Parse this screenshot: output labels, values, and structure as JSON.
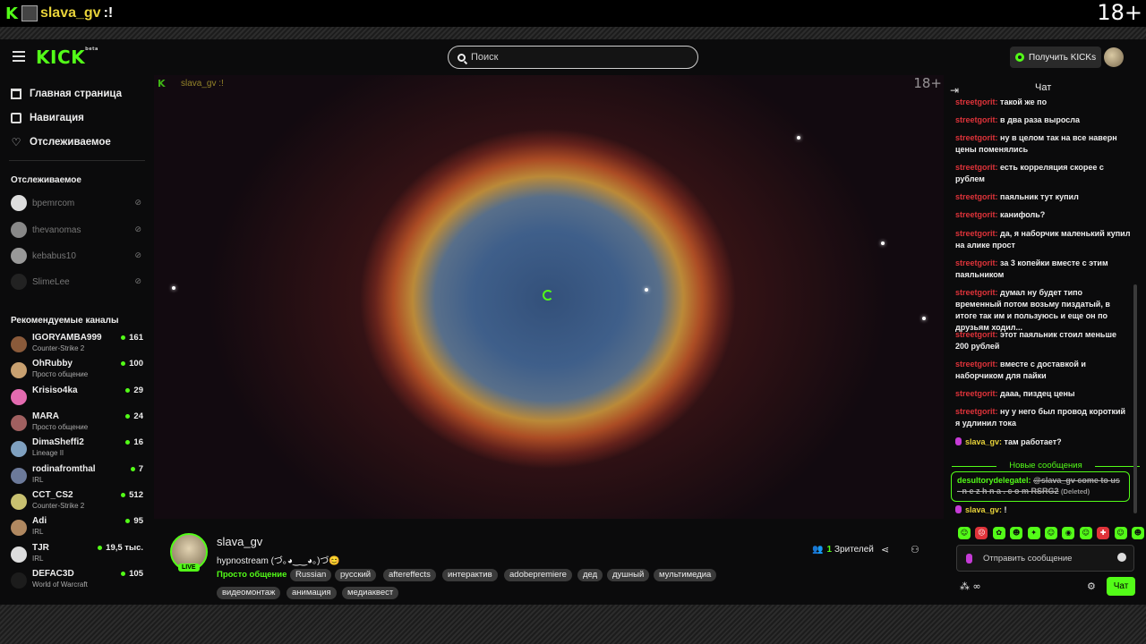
{
  "overlay": {
    "k": "K",
    "name": "slava_gv",
    "mark": ":!",
    "age": "18+"
  },
  "header": {
    "logo": "KICK",
    "logo_sup": "beta",
    "search_placeholder": "Поиск",
    "get_kicks": "Получить KICKs"
  },
  "sidebar": {
    "nav": [
      {
        "label": "Главная страница",
        "icon": "home-icon"
      },
      {
        "label": "Навигация",
        "icon": "compass-icon"
      },
      {
        "label": "Отслеживаемое",
        "icon": "heart-icon"
      }
    ],
    "followed_title": "Отслеживаемое",
    "followed": [
      {
        "name": "bpemrcom"
      },
      {
        "name": "thevanomas"
      },
      {
        "name": "kebabus10"
      },
      {
        "name": "SlimeLee"
      }
    ],
    "recommended_title": "Рекомендуемые каналы",
    "recommended": [
      {
        "name": "IGORYAMBA999",
        "category": "Counter-Strike 2",
        "viewers": "161"
      },
      {
        "name": "OhRubby",
        "category": "Просто общение",
        "viewers": "100"
      },
      {
        "name": "Krisiso4ka",
        "category": "",
        "viewers": "29"
      },
      {
        "name": "MARA",
        "category": "Просто общение",
        "viewers": "24"
      },
      {
        "name": "DimaSheffi2",
        "category": "Lineage II",
        "viewers": "16"
      },
      {
        "name": "rodinafromthal",
        "category": "IRL",
        "viewers": "7"
      },
      {
        "name": "CCT_CS2",
        "category": "Counter-Strike 2",
        "viewers": "512"
      },
      {
        "name": "Adi",
        "category": "IRL",
        "viewers": "95"
      },
      {
        "name": "TJR",
        "category": "IRL",
        "viewers": "19,5 тыс."
      },
      {
        "name": "DEFAC3D",
        "category": "World of Warcraft",
        "viewers": "105"
      }
    ]
  },
  "player": {
    "k": "K",
    "name": "slava_gv :!",
    "age": "18+"
  },
  "stream": {
    "channel": "slava_gv",
    "live": "LIVE",
    "title": "hypnostream (づ｡◕‿‿◕｡)づ😊",
    "category": "Просто общение",
    "tags": [
      "Russian",
      "русский",
      "aftereffects",
      "интерактив",
      "adobepremiere",
      "дед",
      "душный",
      "мультимедиа",
      "видеомонтаж",
      "анимация",
      "медиаквест"
    ],
    "viewers_count": "1",
    "viewers_label": "Зрителей"
  },
  "chat": {
    "title": "Чат",
    "messages": [
      {
        "user": "streetgorit:",
        "text": "такой же по"
      },
      {
        "user": "streetgorit:",
        "text": "в два раза выросла"
      },
      {
        "user": "streetgorit:",
        "text": "ну в целом так на все наверн цены поменялись"
      },
      {
        "user": "streetgorit:",
        "text": "есть корреляция скорее с рублем"
      },
      {
        "user": "streetgorit:",
        "text": "паяльник тут купил"
      },
      {
        "user": "streetgorit:",
        "text": "канифоль?"
      },
      {
        "user": "streetgorit:",
        "text": "да, я наборчик маленький купил на алике прост"
      },
      {
        "user": "streetgorit:",
        "text": "за 3 копейки вместе с этим паяльником"
      },
      {
        "user": "streetgorit:",
        "text": "думал ну будет типо временный потом возьму пиздатый, в итоге так им и пользуюсь и еще он по друзьям ходил..."
      },
      {
        "user": "streetgorit:",
        "text": "этот паяльник стоил меньше 200 рублей"
      },
      {
        "user": "streetgorit:",
        "text": "вместе с доставкой и наборчиком для пайки"
      },
      {
        "user": "streetgorit:",
        "text": "дааа, пиздец цены"
      },
      {
        "user": "streetgorit:",
        "text": "ну у него был провод короткий я удлинил тока"
      }
    ],
    "slava_msg1": {
      "user": "slava_gv:",
      "text": "там работает?"
    },
    "new_messages": "Новые сообщения",
    "highlight": {
      "user": "desultorydelegatel:",
      "text": "@slava_gv come to us - n e z h n a . c o m RSRG2",
      "deleted": "(Deleted)"
    },
    "slava_msg2": {
      "user": "slava_gv:",
      "text": "!"
    },
    "input_placeholder": "Отправить сообщение",
    "points": "∞",
    "send": "Чат"
  }
}
